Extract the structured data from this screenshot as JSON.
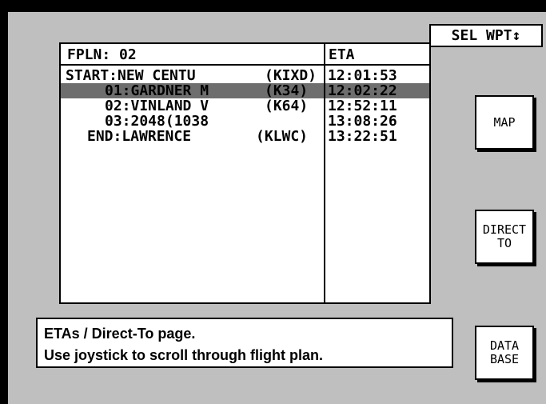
{
  "header": {
    "fpln_label": "FPLN: 02",
    "eta_label": "ETA",
    "sel_wpt": "SEL WPT↕"
  },
  "rows": [
    {
      "name": "START:NEW CENTU",
      "id": "(KIXD)",
      "eta": "12:01:53",
      "selected": false
    },
    {
      "name": "01:GARDNER M",
      "id": "(K34)",
      "eta": "12:02:22",
      "selected": true
    },
    {
      "name": "02:VINLAND V",
      "id": "(K64)",
      "eta": "12:52:11",
      "selected": false
    },
    {
      "name": "03:2048(1038",
      "id": "",
      "eta": "13:08:26",
      "selected": false
    },
    {
      "name": "END:LAWRENCE",
      "id": "(KLWC)",
      "eta": "13:22:51",
      "selected": false
    }
  ],
  "buttons": {
    "map": "MAP",
    "direct_line1": "DIRECT",
    "direct_line2": "TO",
    "database_line1": "DATA",
    "database_line2": "BASE"
  },
  "status": {
    "line1": "ETAs / Direct-To page.",
    "line2": "Use joystick to scroll through flight plan."
  },
  "colors": {
    "background": "#bfbfbf",
    "selection": "#6e6e6e"
  }
}
